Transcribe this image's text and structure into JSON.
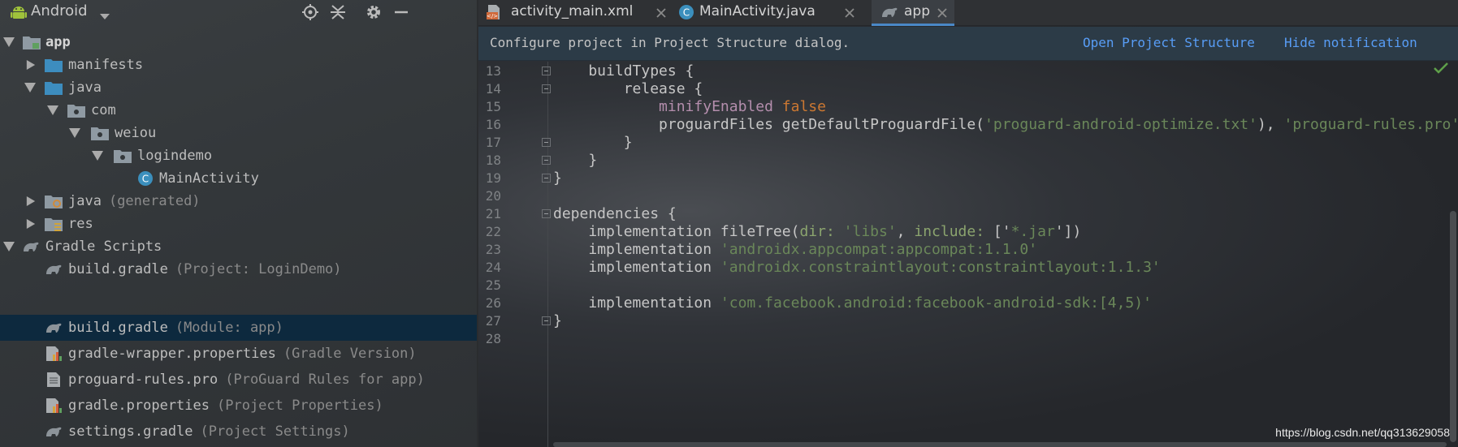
{
  "project_panel": {
    "view_label": "Android",
    "header_buttons": [
      "locate-icon",
      "collapse-all-icon",
      "gear-icon",
      "hide-icon"
    ],
    "tree": [
      {
        "label": "app",
        "hint": "",
        "icon": "module-folder-icon"
      },
      {
        "label": "manifests",
        "hint": "",
        "icon": "folder-icon"
      },
      {
        "label": "java",
        "hint": "",
        "icon": "folder-icon"
      },
      {
        "label": "com",
        "hint": "",
        "icon": "package-icon"
      },
      {
        "label": "weiou",
        "hint": "",
        "icon": "package-icon"
      },
      {
        "label": "logindemo",
        "hint": "",
        "icon": "package-icon"
      },
      {
        "label": "MainActivity",
        "hint": "",
        "icon": "class-icon"
      },
      {
        "label": "java",
        "hint": "(generated)",
        "icon": "generated-folder-icon"
      },
      {
        "label": "res",
        "hint": "",
        "icon": "resources-folder-icon"
      },
      {
        "label": "Gradle Scripts",
        "hint": "",
        "icon": "gradle-icon"
      },
      {
        "label": "build.gradle",
        "hint": "(Project: LoginDemo)",
        "icon": "gradle-icon"
      },
      {
        "label": "build.gradle",
        "hint": "(Module: app)",
        "icon": "gradle-icon"
      },
      {
        "label": "gradle-wrapper.properties",
        "hint": "(Gradle Version)",
        "icon": "properties-icon"
      },
      {
        "label": "proguard-rules.pro",
        "hint": "(ProGuard Rules for app)",
        "icon": "text-file-icon"
      },
      {
        "label": "gradle.properties",
        "hint": "(Project Properties)",
        "icon": "properties-icon"
      },
      {
        "label": "settings.gradle",
        "hint": "(Project Settings)",
        "icon": "gradle-icon"
      }
    ]
  },
  "editor": {
    "tabs": [
      {
        "label": "activity_main.xml",
        "icon": "xml-file-icon",
        "active": false
      },
      {
        "label": "MainActivity.java",
        "icon": "class-icon",
        "active": false
      },
      {
        "label": "app",
        "icon": "gradle-icon",
        "active": true
      }
    ],
    "notification": {
      "message": "Configure project in Project Structure dialog.",
      "open_link": "Open Project Structure",
      "hide_link": "Hide notification"
    },
    "line_numbers": [
      "13",
      "14",
      "15",
      "16",
      "17",
      "18",
      "19",
      "20",
      "21",
      "22",
      "23",
      "24",
      "25",
      "26",
      "27",
      "28"
    ],
    "code": {
      "l13": "    buildTypes {",
      "l14": "        release {",
      "l15a": "minifyEnabled",
      "l15b": "false",
      "l16a": "proguardFiles getDefaultProguardFile(",
      "l16b": "'proguard-android-optimize.txt'",
      "l16c": "), ",
      "l16d": "'proguard-rules.pro'",
      "l17": "        }",
      "l18": "    }",
      "l19": "}",
      "l21": "dependencies {",
      "l22a": "implementation fileTree(",
      "l22b": "dir: ",
      "l22c": "'libs'",
      "l22d": ", ",
      "l22e": "include: ",
      "l22f": "['",
      "l22g": "*.jar",
      "l22h": "'])",
      "l23a": "implementation ",
      "l23b": "'androidx.appcompat:appcompat:1.1.0'",
      "l24a": "implementation ",
      "l24b": "'androidx.constraintlayout:constraintlayout:1.1.3'",
      "l26a": "implementation ",
      "l26b": "'com.facebook.android:facebook-android-sdk:[4,5)'",
      "l27": "}"
    }
  },
  "watermark": "https://blog.csdn.net/qq313629058",
  "colors": {
    "selection": "#0d293e",
    "link": "#589df6",
    "string": "#6a8759",
    "keyword": "#cc7832",
    "property": "#b48ead",
    "tab_underline": "#4a88c7"
  }
}
